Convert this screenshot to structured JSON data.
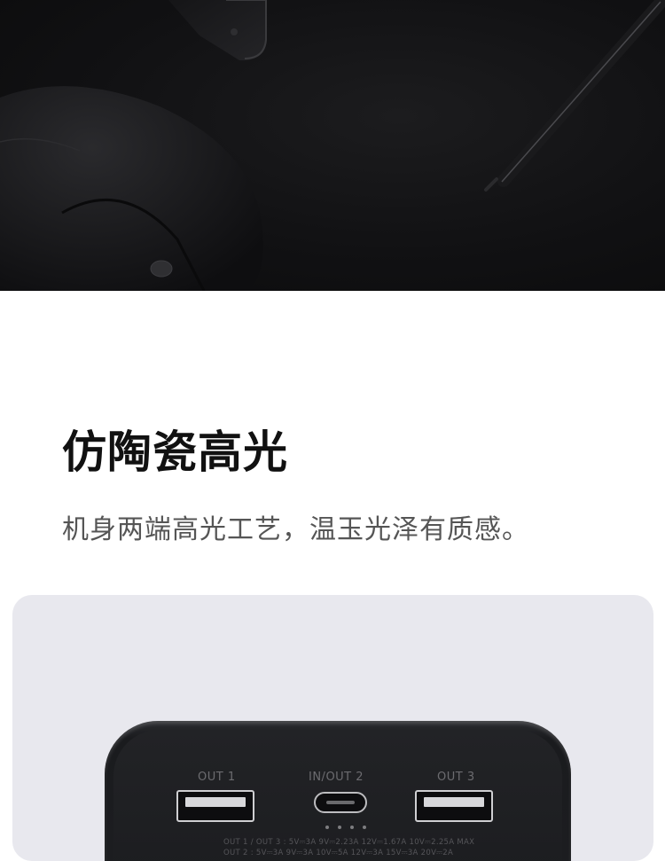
{
  "headline": "仿陶瓷高光",
  "subline": "机身两端高光工艺，温玉光泽有质感。",
  "product": {
    "port_labels": [
      "OUT 1",
      "IN/OUT 2",
      "OUT 3"
    ],
    "spec_line_1": "OUT 1 / OUT 3 :  5V⎓3A  9V⎓2.23A  12V⎓1.67A  10V⎓2.25A  MAX",
    "spec_line_2": "OUT 2 :  5V⎓3A  9V⎓3A  10V⎓5A  12V⎓3A  15V⎓3A  20V⎓2A"
  },
  "colors": {
    "hero_background": "#111113",
    "panel_background": "#e8e8ee",
    "headline_text": "#111111",
    "subline_text": "#555555"
  }
}
